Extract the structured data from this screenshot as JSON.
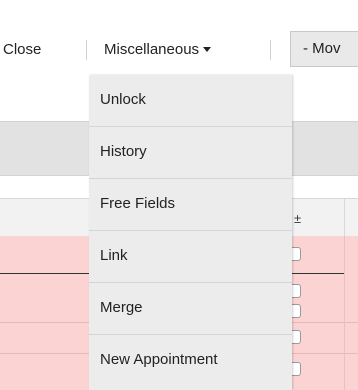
{
  "toolbar": {
    "close_label": "Close",
    "misc_label": "Miscellaneous",
    "move_label": "- Mov"
  },
  "table": {
    "sort_icon": "±"
  },
  "menu": {
    "items": [
      {
        "label": "Unlock"
      },
      {
        "label": "History"
      },
      {
        "label": "Free Fields"
      },
      {
        "label": "Link"
      },
      {
        "label": "Merge"
      },
      {
        "label": "New Appointment"
      }
    ]
  }
}
